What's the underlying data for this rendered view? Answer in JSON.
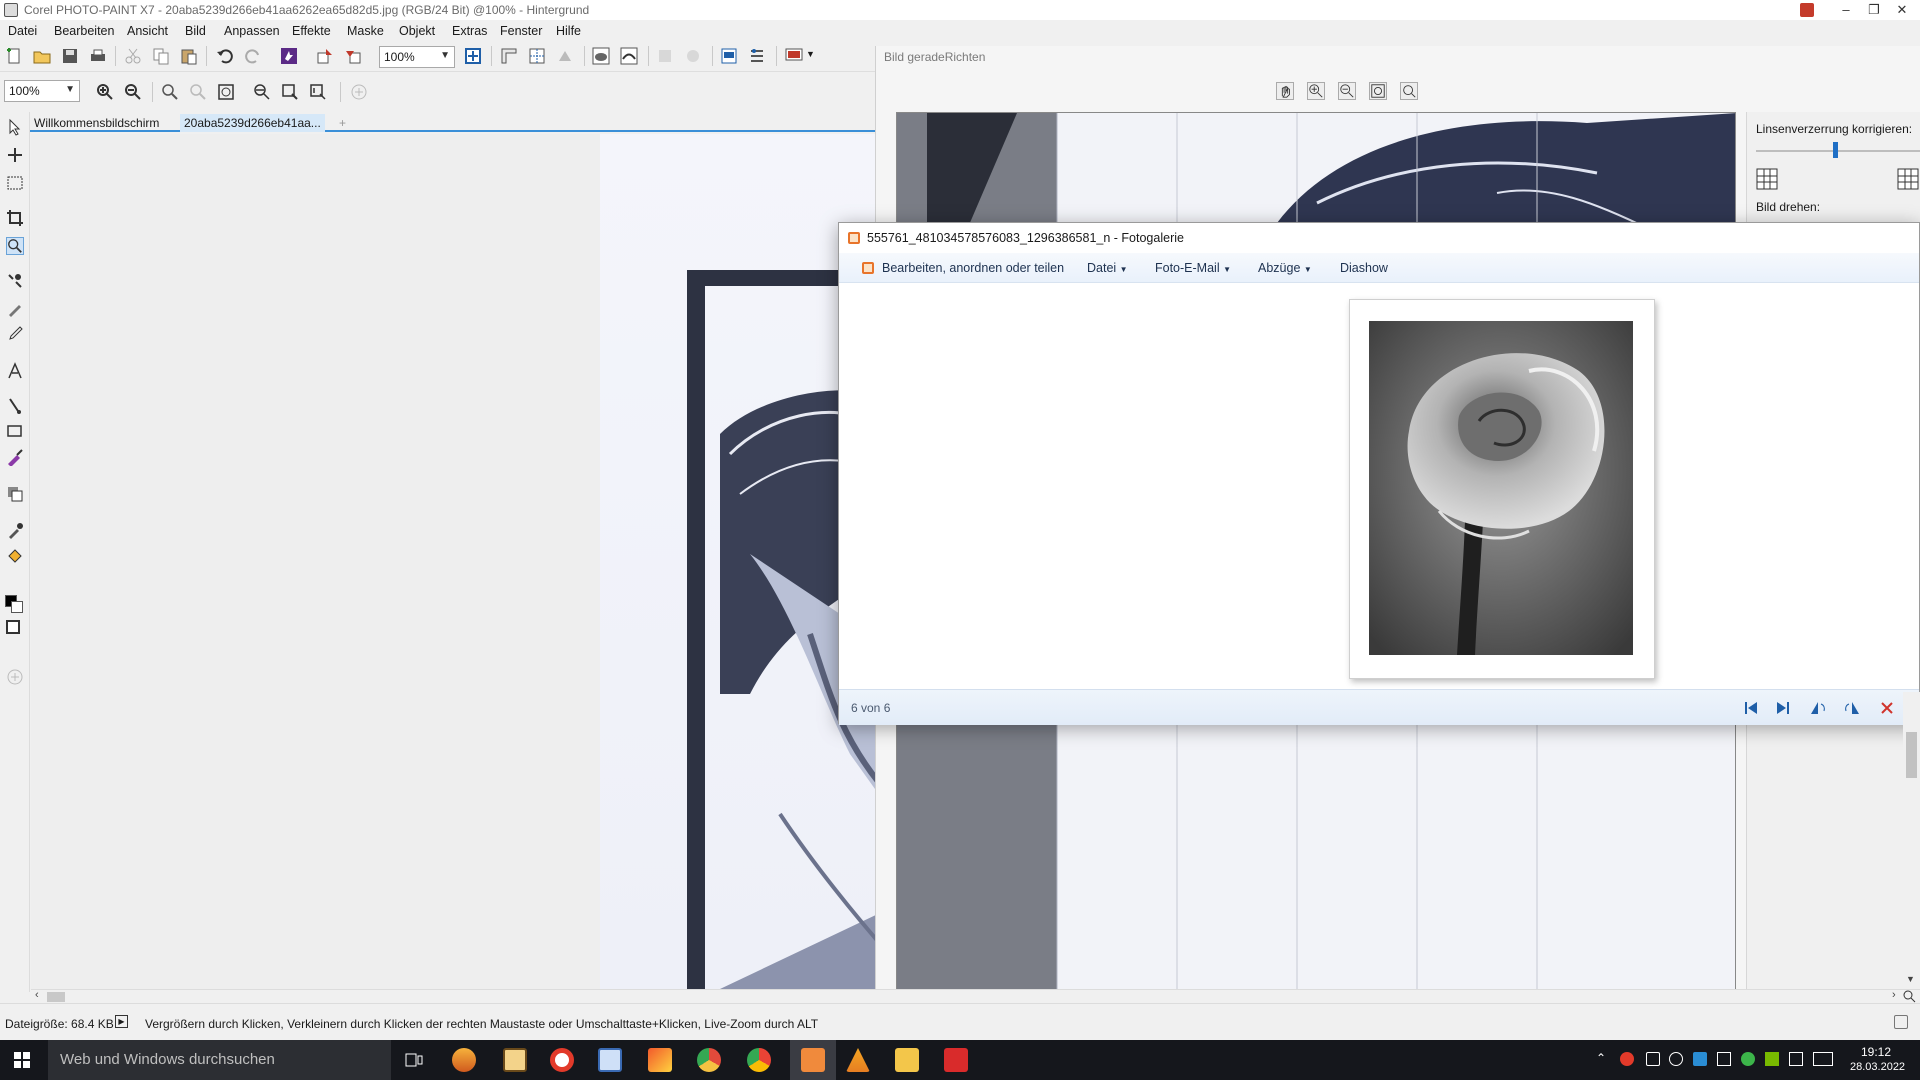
{
  "app_window": {
    "title": "Corel PHOTO-PAINT X7 - 20aba5239d266eb41aa6262ea65d82d5.jpg (RGB/24 Bit) @100% - Hintergrund"
  },
  "menubar": {
    "items": [
      "Datei",
      "Bearbeiten",
      "Ansicht",
      "Bild",
      "Anpassen",
      "Effekte",
      "Maske",
      "Objekt",
      "Extras",
      "Fenster",
      "Hilfe"
    ]
  },
  "toolbar": {
    "zoom_value": "100%",
    "zoom_value_2": "100%"
  },
  "doc_tabs": {
    "welcome": "Willkommensbildschirm",
    "document": "20aba5239d266eb41aa..."
  },
  "straighten_panel": {
    "title": "Bild geradeRichten",
    "lens_label": "Linsenverzerrung korrigieren:",
    "rotate_label": "Bild drehen:"
  },
  "gallery": {
    "title": "555761_481034578576083_1296386581_n - Fotogalerie",
    "menu": {
      "edit": "Bearbeiten, anordnen oder teilen",
      "file": "Datei",
      "email": "Foto-E-Mail",
      "prints": "Abzüge",
      "slideshow": "Diashow"
    },
    "counter": "6 von 6"
  },
  "statusbar": {
    "filesize": "Dateigröße: 68.4 KB",
    "hint": "Vergrößern durch Klicken, Verkleinern durch Klicken der rechten Maustaste oder Umschalttaste+Klicken, Live-Zoom durch ALT"
  },
  "taskbar": {
    "search_placeholder": "Web und Windows durchsuchen",
    "time": "19:12",
    "date": "28.03.2022"
  },
  "colors": {
    "accent": "#3a8fd8",
    "taskbar": "#15171c",
    "gallery_toolbar": "#e9f1fb"
  }
}
